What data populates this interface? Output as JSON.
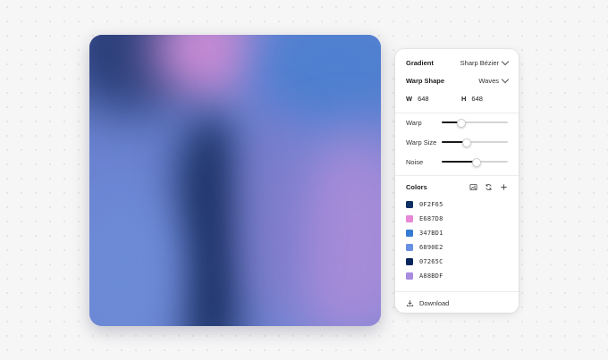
{
  "panel": {
    "gradient": {
      "label": "Gradient",
      "value": "Sharp Bézier"
    },
    "warp_shape": {
      "label": "Warp Shape",
      "value": "Waves"
    },
    "size": {
      "w_label": "W",
      "w_value": "648",
      "h_label": "H",
      "h_value": "648"
    },
    "sliders": [
      {
        "label": "Warp",
        "value": 0.28
      },
      {
        "label": "Warp Size",
        "value": 0.36
      },
      {
        "label": "Noise",
        "value": 0.52
      }
    ],
    "colors_label": "Colors",
    "colors": [
      {
        "hex": "0F2F65",
        "swatch": "#0F2F65"
      },
      {
        "hex": "E687D8",
        "swatch": "#E687D8"
      },
      {
        "hex": "347BD1",
        "swatch": "#347BD1"
      },
      {
        "hex": "6890E2",
        "swatch": "#6890E2"
      },
      {
        "hex": "07265C",
        "swatch": "#07265C"
      },
      {
        "hex": "A88BDF",
        "swatch": "#A88BDF"
      }
    ],
    "download_label": "Download",
    "icons": [
      "image-icon",
      "refresh-icon",
      "plus-icon",
      "download-icon",
      "chevron-down-icon"
    ]
  }
}
